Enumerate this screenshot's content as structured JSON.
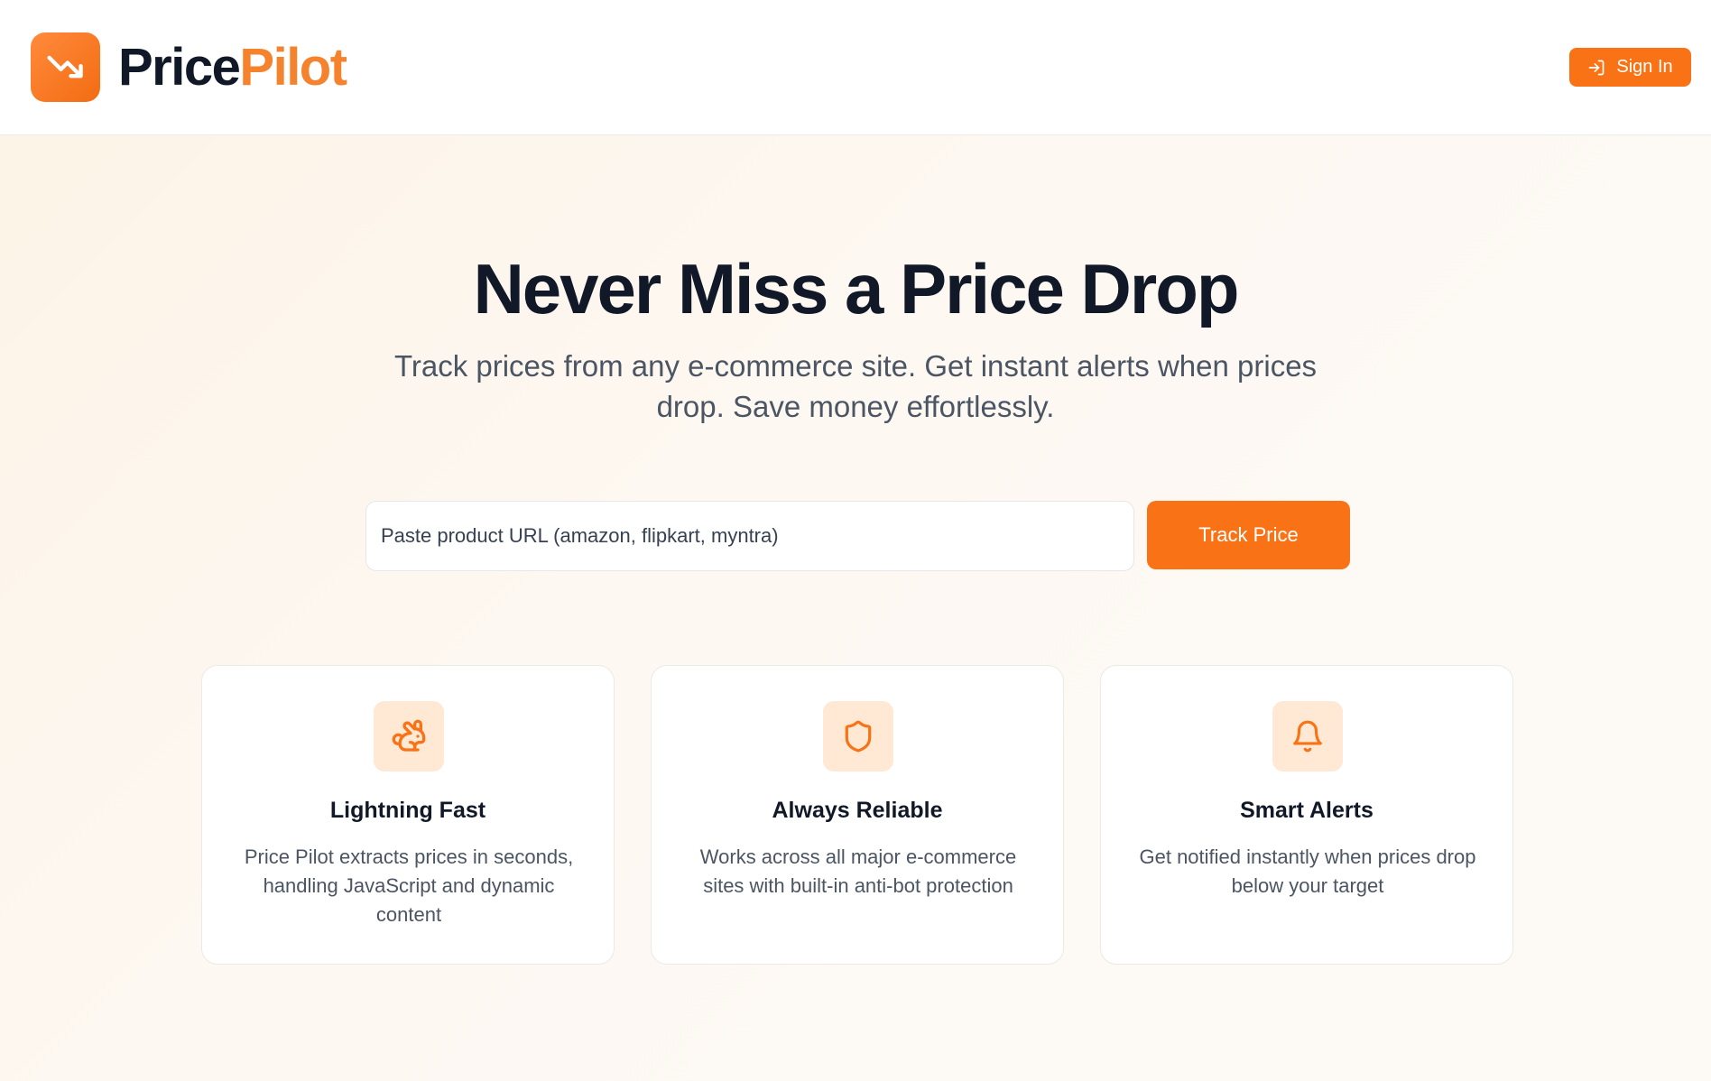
{
  "header": {
    "logo_price": "Price",
    "logo_pilot": "Pilot",
    "logo_icon": "trending-down-icon",
    "signin_label": "Sign In",
    "signin_icon": "log-in-icon"
  },
  "hero": {
    "title": "Never Miss a Price Drop",
    "subtitle": "Track prices from any e-commerce site. Get instant alerts when prices drop. Save money effortlessly."
  },
  "search": {
    "placeholder": "Paste product URL (amazon, flipkart, myntra)",
    "value": "",
    "button_label": "Track Price"
  },
  "features": [
    {
      "icon": "rabbit-icon",
      "title": "Lightning Fast",
      "description": "Price Pilot extracts prices in seconds, handling JavaScript and dynamic content"
    },
    {
      "icon": "shield-icon",
      "title": "Always Reliable",
      "description": "Works across all major e-commerce sites with built-in anti-bot protection"
    },
    {
      "icon": "bell-icon",
      "title": "Smart Alerts",
      "description": "Get notified instantly when prices drop below your target"
    }
  ],
  "colors": {
    "accent": "#f97316",
    "accent_light": "#ffe8d4",
    "text_dark": "#111827",
    "text_muted": "#4b5563"
  }
}
